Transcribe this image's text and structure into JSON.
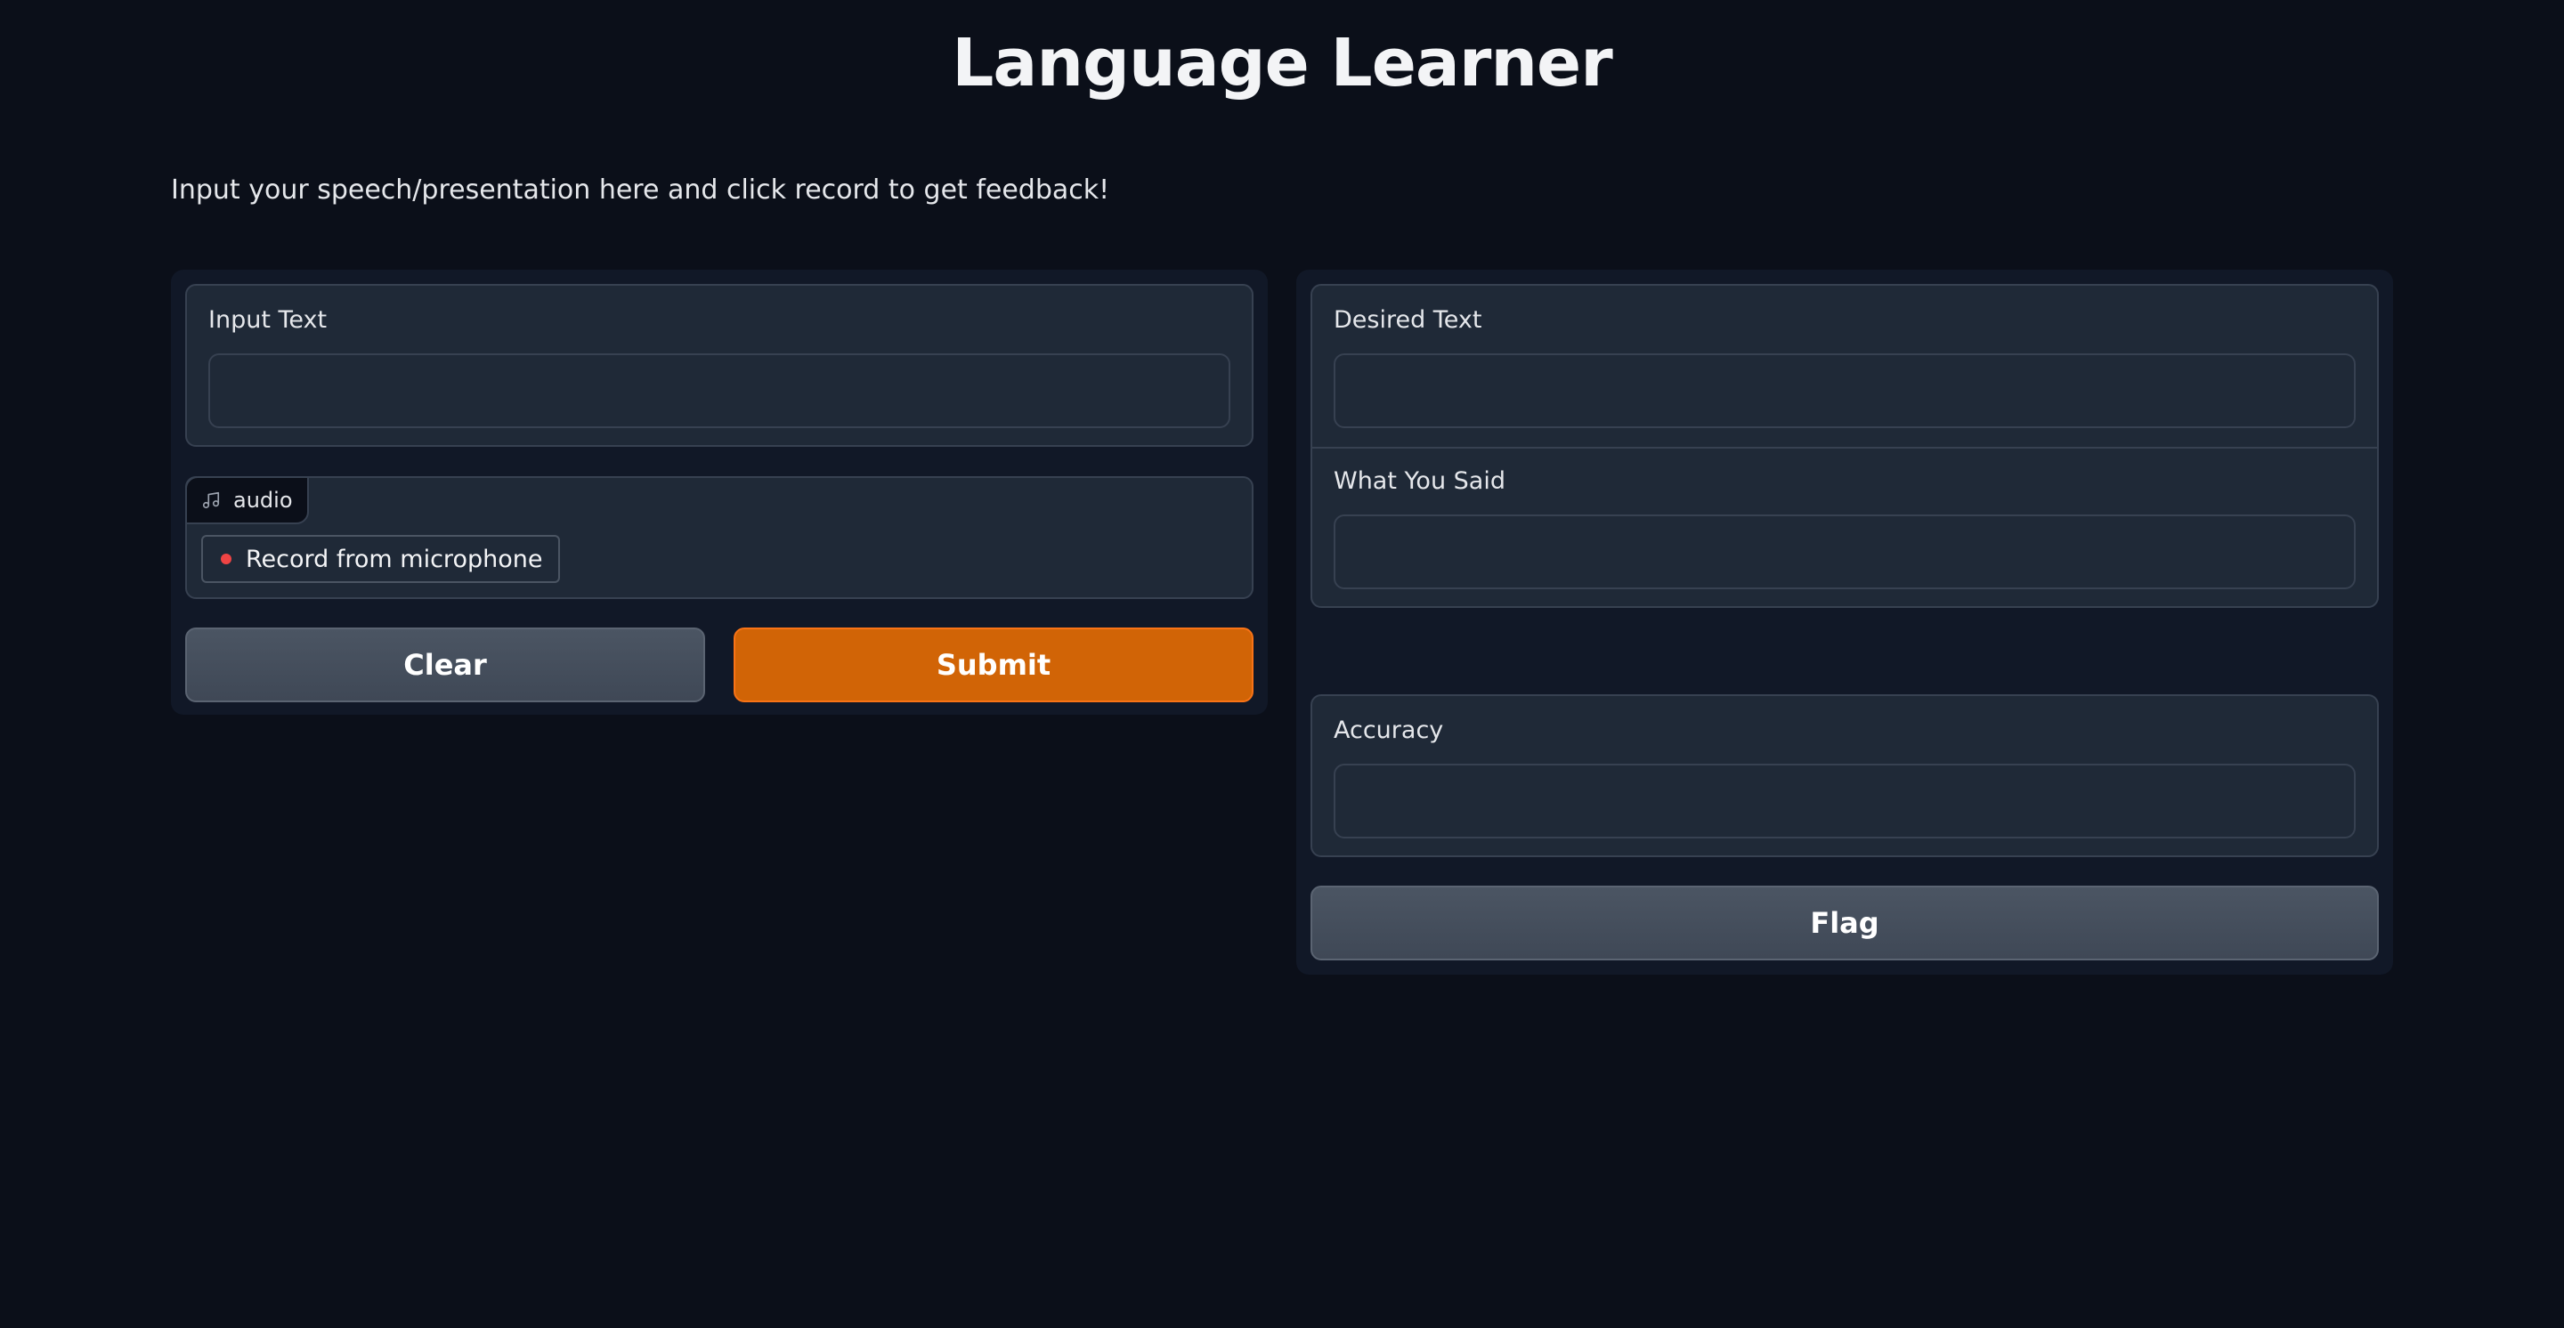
{
  "header": {
    "title": "Language Learner",
    "description": "Input your speech/presentation here and click record to get feedback!"
  },
  "inputs": {
    "input_text_label": "Input Text",
    "input_text_value": "",
    "audio_badge_label": "audio",
    "audio_badge_icon": "music-note-icon",
    "record_label": "Record from microphone",
    "record_icon": "record-dot-icon"
  },
  "actions": {
    "clear_label": "Clear",
    "submit_label": "Submit",
    "flag_label": "Flag"
  },
  "outputs": {
    "desired_text_label": "Desired Text",
    "desired_text_value": "",
    "what_you_said_label": "What You Said",
    "what_you_said_value": "",
    "accuracy_label": "Accuracy",
    "accuracy_value": ""
  },
  "colors": {
    "background": "#0b0f19",
    "panel": "#111827",
    "block": "#1f2937",
    "border": "#374151",
    "primary": "#d16406",
    "secondary": "#4b5563",
    "record_dot": "#ef4444"
  }
}
